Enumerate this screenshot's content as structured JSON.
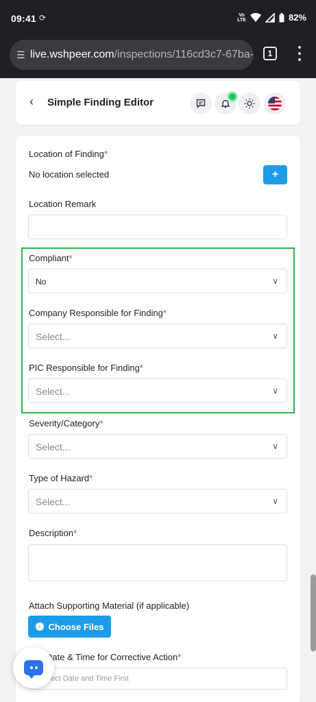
{
  "status_bar": {
    "time": "09:41",
    "network_top": "Vo",
    "network_bottom": "LTE",
    "battery": "82%"
  },
  "browser": {
    "url_host": "live.wshpeer.com",
    "url_path": "/inspections/116cd3c7-67ba-",
    "tab_count": "1"
  },
  "header": {
    "title": "Simple Finding Editor"
  },
  "form": {
    "location": {
      "label": "Location of Finding",
      "required_mark": "*",
      "value": "No location selected",
      "add_label": "+"
    },
    "location_remark": {
      "label": "Location Remark",
      "value": ""
    },
    "compliant": {
      "label": "Compliant",
      "required_mark": "*",
      "value": "No"
    },
    "company_responsible": {
      "label": "Company Responsible for Finding",
      "required_mark": "*",
      "placeholder": "Select..."
    },
    "pic_responsible": {
      "label": "PIC Responsible for Finding",
      "required_mark": "*",
      "placeholder": "Select..."
    },
    "severity": {
      "label": "Severity/Category",
      "required_mark": "*",
      "placeholder": "Select..."
    },
    "hazard_type": {
      "label": "Type of Hazard",
      "required_mark": "*",
      "placeholder": "Select..."
    },
    "description": {
      "label": "Description",
      "required_mark": "*",
      "value": ""
    },
    "attachments": {
      "label": "Attach Supporting Material (if applicable)",
      "button_label": "Choose Files"
    },
    "due_date": {
      "label": "Date & Time for Corrective Action",
      "required_mark": "*",
      "placeholder": "ect Date and Time First"
    }
  },
  "colors": {
    "accent": "#1e9be9",
    "highlight": "#2db34a",
    "required": "#e53935",
    "chat": "#2a73ea"
  }
}
